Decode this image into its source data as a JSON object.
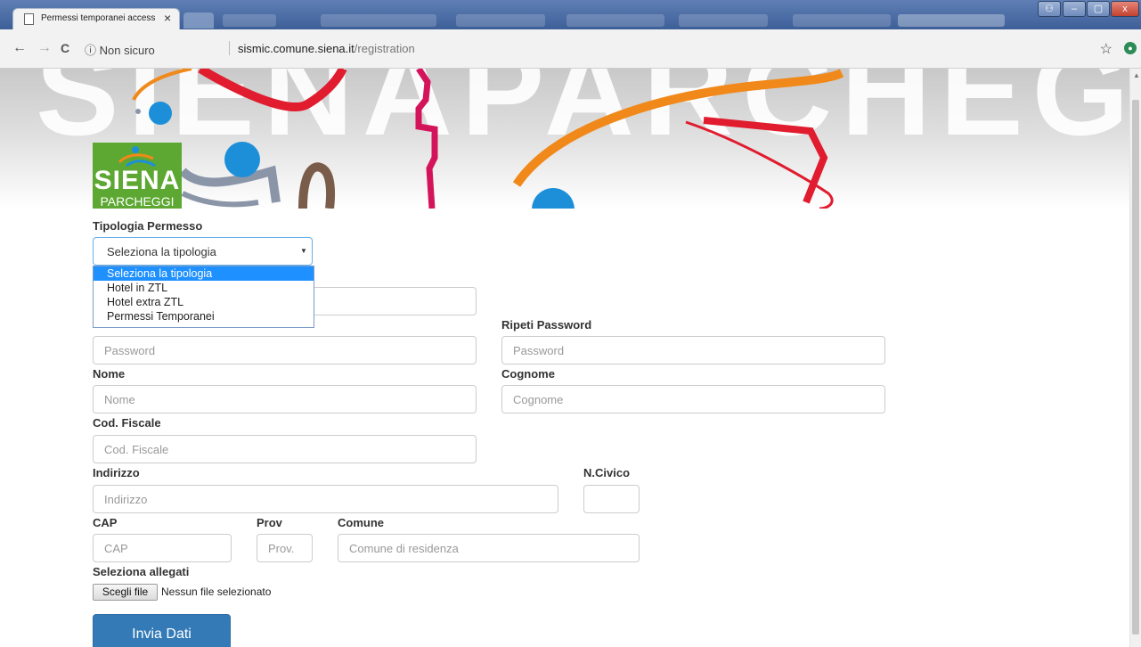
{
  "browser": {
    "tab_title": "Permessi temporanei accesso",
    "tab_close": "×",
    "security_label": "ⓘ Non sicuro",
    "url_host": "sismic.comune.siena.it",
    "url_path": "/registration",
    "nav_back": "←",
    "nav_forward": "→",
    "nav_reload": "C",
    "star": "☆",
    "window_controls": [
      "–",
      "▢",
      "x"
    ]
  },
  "banner": {
    "text": "SIENAPARCHEGGI S",
    "logo_line1": "SIENA",
    "logo_line2": "PARCHEGGI",
    "colors": {
      "orange": "#f0891a",
      "red": "#e01c2e",
      "magenta": "#d4145a",
      "blue": "#1d8fd9",
      "brown": "#7a5c4a",
      "grey": "#8a95a8",
      "logo_green": "#5da832"
    }
  },
  "form": {
    "tipologia": {
      "label": "Tipologia Permesso",
      "selected": "Seleziona la tipologia",
      "options": [
        "Seleziona la tipologia",
        "Hotel in ZTL",
        "Hotel extra ZTL",
        "Permessi Temporanei"
      ]
    },
    "password": {
      "placeholder": "Password"
    },
    "repeat_password": {
      "label": "Ripeti Password",
      "placeholder": "Password"
    },
    "nome": {
      "label": "Nome",
      "placeholder": "Nome"
    },
    "cognome": {
      "label": "Cognome",
      "placeholder": "Cognome"
    },
    "cod_fiscale": {
      "label": "Cod. Fiscale",
      "placeholder": "Cod. Fiscale"
    },
    "indirizzo": {
      "label": "Indirizzo",
      "placeholder": "Indirizzo"
    },
    "civico": {
      "label": "N.Civico",
      "placeholder": ""
    },
    "cap": {
      "label": "CAP",
      "placeholder": "CAP"
    },
    "prov": {
      "label": "Prov",
      "placeholder": "Prov."
    },
    "comune": {
      "label": "Comune",
      "placeholder": "Comune di residenza"
    },
    "allegati": {
      "label": "Seleziona allegati",
      "button": "Scegli file",
      "status": "Nessun file selezionato"
    },
    "submit_label": "Invia Dati"
  }
}
